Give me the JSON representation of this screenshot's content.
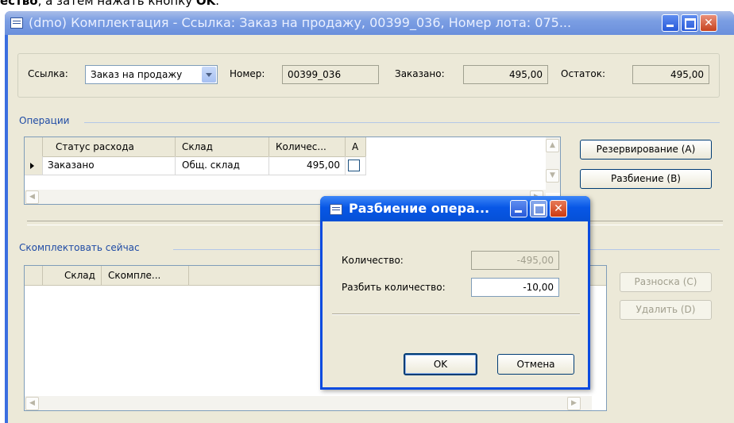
{
  "caption": {
    "before": "ество",
    "middle": ", а затем нажать кнопку ",
    "bold": "OK",
    "after": "."
  },
  "window": {
    "title": "(dmo) Комплектация - Ссылка: Заказ на продажу, 00399_036, Номер лота: 075..."
  },
  "reference": {
    "ref_label": "Ссылка:",
    "ref_value": "Заказ на продажу",
    "number_label": "Номер:",
    "number_value": "00399_036",
    "ordered_label": "Заказано:",
    "ordered_value": "495,00",
    "remain_label": "Остаток:",
    "remain_value": "495,00"
  },
  "operations": {
    "title": "Операции",
    "columns": [
      "Статус расхода",
      "Склад",
      "Количес...",
      "А"
    ],
    "rows": [
      {
        "status": "Заказано",
        "warehouse": "Общ. склад",
        "qty": "495,00",
        "checked": false
      }
    ],
    "reserve_button": "Резервирование (A)",
    "split_button": "Разбиение (B)"
  },
  "pick_now": {
    "title": "Скомплектовать сейчас",
    "columns": [
      "Склад",
      "Скомпле..."
    ],
    "post_button": "Разноска (C)",
    "delete_button": "Удалить (D)"
  },
  "dialog": {
    "title": "Разбиение опера...",
    "qty_label": "Количество:",
    "qty_value": "-495,00",
    "split_label": "Разбить количество:",
    "split_value": "-10,00",
    "ok": "OK",
    "cancel": "Отмена"
  }
}
